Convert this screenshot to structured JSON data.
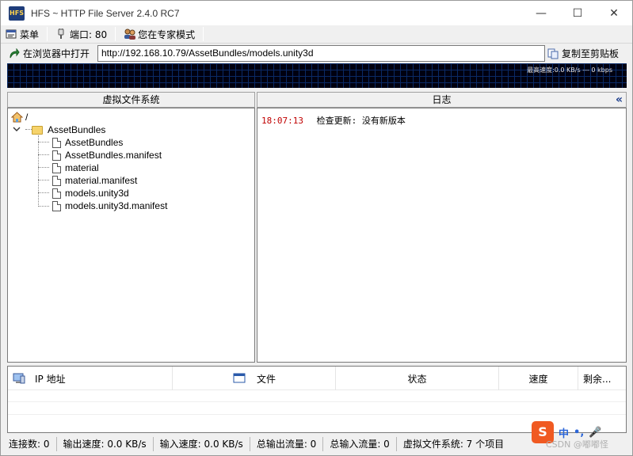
{
  "window": {
    "title": "HFS ~ HTTP File Server 2.4.0 RC7",
    "icon_text": "HFS",
    "minimize_label": "—",
    "maximize_label": "☐",
    "close_label": "✕"
  },
  "menubar": {
    "menu_label": "菜单",
    "port_label": "端口: 80",
    "mode_label": "您在专家模式"
  },
  "urlbar": {
    "open_label": "在浏览器中打开",
    "url": "http://192.168.10.79/AssetBundles/models.unity3d",
    "copy_label": "复制至剪贴板"
  },
  "graph": {
    "speed_label": "最高速度:0.0 KB/s  ---  0 kbps"
  },
  "vfs": {
    "header": "虚拟文件系统",
    "root_label": "/",
    "folder_label": "AssetBundles",
    "files": [
      "AssetBundles",
      "AssetBundles.manifest",
      "material",
      "material.manifest",
      "models.unity3d",
      "models.unity3d.manifest"
    ]
  },
  "log": {
    "header": "日志",
    "collapse_label": "«",
    "entries": [
      {
        "time": "18:07:13",
        "message": "检查更新: 没有新版本"
      }
    ]
  },
  "connections": {
    "columns": [
      "IP 地址",
      "文件",
      "状态",
      "速度",
      "剩余..."
    ]
  },
  "statusbar": {
    "connections": "连接数: 0",
    "out_speed": "输出速度: 0.0 KB/s",
    "in_speed": "输入速度: 0.0 KB/s",
    "total_out": "总输出流量: 0",
    "total_in": "总输入流量: 0",
    "vfs_items": "虚拟文件系统: 7 个项目"
  },
  "ime": {
    "logo": "S",
    "lang": "中",
    "punct": "•,",
    "mic": "🎤"
  },
  "watermark": "CSDN @嘟嘟怪"
}
